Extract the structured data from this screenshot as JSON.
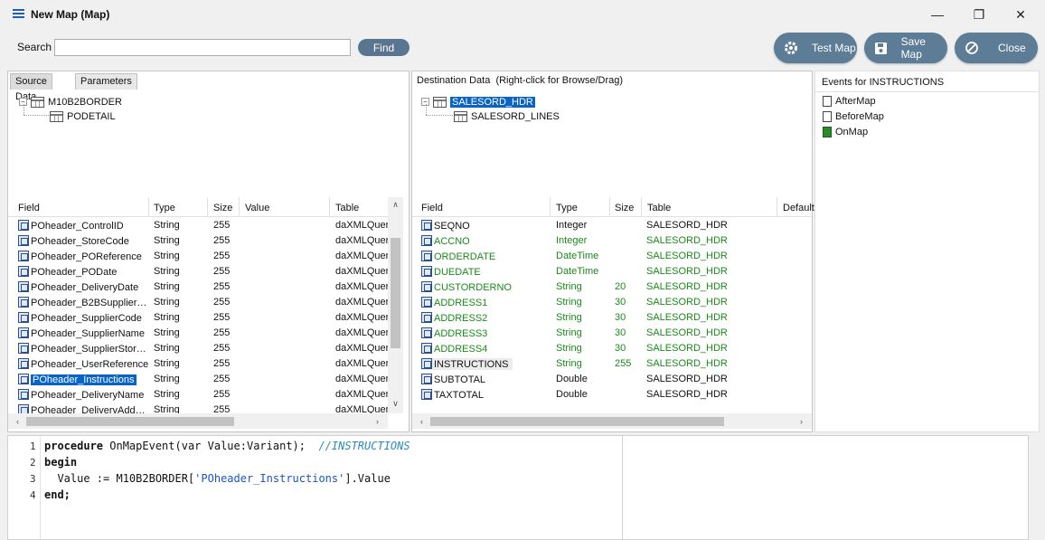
{
  "window": {
    "title": "New Map (Map)"
  },
  "toolbar": {
    "search_label": "Search",
    "search_value": "",
    "find_label": "Find",
    "test_map_label": "Test Map",
    "save_map_label": "Save Map",
    "close_label": "Close"
  },
  "source": {
    "tabs": [
      "Source Data",
      "Parameters"
    ],
    "tree": {
      "root": "M10B2BORDER",
      "child": "PODETAIL"
    },
    "columns": [
      "Field",
      "Type",
      "Size",
      "Value",
      "Table"
    ],
    "rows": [
      {
        "field": "POheader_ControlID",
        "type": "String",
        "size": "255",
        "value": "",
        "table": "daXMLQuery"
      },
      {
        "field": "POheader_StoreCode",
        "type": "String",
        "size": "255",
        "value": "",
        "table": "daXMLQuery"
      },
      {
        "field": "POheader_POReference",
        "type": "String",
        "size": "255",
        "value": "",
        "table": "daXMLQuery"
      },
      {
        "field": "POheader_PODate",
        "type": "String",
        "size": "255",
        "value": "",
        "table": "daXMLQuery"
      },
      {
        "field": "POheader_DeliveryDate",
        "type": "String",
        "size": "255",
        "value": "",
        "table": "daXMLQuery"
      },
      {
        "field": "POheader_B2BSupplier…",
        "type": "String",
        "size": "255",
        "value": "",
        "table": "daXMLQuery"
      },
      {
        "field": "POheader_SupplierCode",
        "type": "String",
        "size": "255",
        "value": "",
        "table": "daXMLQuery"
      },
      {
        "field": "POheader_SupplierName",
        "type": "String",
        "size": "255",
        "value": "",
        "table": "daXMLQuery"
      },
      {
        "field": "POheader_SupplierStor…",
        "type": "String",
        "size": "255",
        "value": "",
        "table": "daXMLQuery"
      },
      {
        "field": "POheader_UserReference",
        "type": "String",
        "size": "255",
        "value": "",
        "table": "daXMLQuery"
      },
      {
        "field": "POheader_Instructions",
        "type": "String",
        "size": "255",
        "value": "",
        "table": "daXMLQuery"
      },
      {
        "field": "POheader_DeliveryName",
        "type": "String",
        "size": "255",
        "value": "",
        "table": "daXMLQuery"
      },
      {
        "field": "POheader_DeliveryAdd…",
        "type": "String",
        "size": "255",
        "value": "",
        "table": "daXMLQuery"
      }
    ]
  },
  "destination": {
    "header": "Destination Data",
    "hint": "(Right-click for Browse/Drag)",
    "tree": {
      "root": "SALESORD_HDR",
      "child": "SALESORD_LINES"
    },
    "columns": [
      "Field",
      "Type",
      "Size",
      "Table",
      "Default"
    ],
    "rows": [
      {
        "field": "SEQNO",
        "type": "Integer",
        "size": "",
        "table": "SALESORD_HDR",
        "mapped": false
      },
      {
        "field": "ACCNO",
        "type": "Integer",
        "size": "",
        "table": "SALESORD_HDR",
        "mapped": true
      },
      {
        "field": "ORDERDATE",
        "type": "DateTime",
        "size": "",
        "table": "SALESORD_HDR",
        "mapped": true
      },
      {
        "field": "DUEDATE",
        "type": "DateTime",
        "size": "",
        "table": "SALESORD_HDR",
        "mapped": true
      },
      {
        "field": "CUSTORDERNO",
        "type": "String",
        "size": "20",
        "table": "SALESORD_HDR",
        "mapped": true
      },
      {
        "field": "ADDRESS1",
        "type": "String",
        "size": "30",
        "table": "SALESORD_HDR",
        "mapped": true
      },
      {
        "field": "ADDRESS2",
        "type": "String",
        "size": "30",
        "table": "SALESORD_HDR",
        "mapped": true
      },
      {
        "field": "ADDRESS3",
        "type": "String",
        "size": "30",
        "table": "SALESORD_HDR",
        "mapped": true
      },
      {
        "field": "ADDRESS4",
        "type": "String",
        "size": "30",
        "table": "SALESORD_HDR",
        "mapped": true
      },
      {
        "field": "INSTRUCTIONS",
        "type": "String",
        "size": "255",
        "table": "SALESORD_HDR",
        "mapped": true
      },
      {
        "field": "SUBTOTAL",
        "type": "Double",
        "size": "",
        "table": "SALESORD_HDR",
        "mapped": false
      },
      {
        "field": "TAXTOTAL",
        "type": "Double",
        "size": "",
        "table": "SALESORD_HDR",
        "mapped": false
      }
    ]
  },
  "events": {
    "header": "Events for INSTRUCTIONS",
    "items": [
      "AfterMap",
      "BeforeMap",
      "OnMap"
    ]
  },
  "code": {
    "line_numbers": [
      "1",
      "2",
      "3",
      "4"
    ],
    "line1_kw": "procedure",
    "line1_rest": " OnMapEvent(var Value:Variant);  ",
    "line1_comment": "//INSTRUCTIONS",
    "line2": "begin",
    "line3_pre": "  Value := M10B2BORDER[",
    "line3_str": "'POheader_Instructions'",
    "line3_post": "].Value",
    "line4": "end;"
  },
  "colors": {
    "accent": "#0a64c8",
    "button": "#5d7c96",
    "mapped_text": "#1a8a1a"
  }
}
